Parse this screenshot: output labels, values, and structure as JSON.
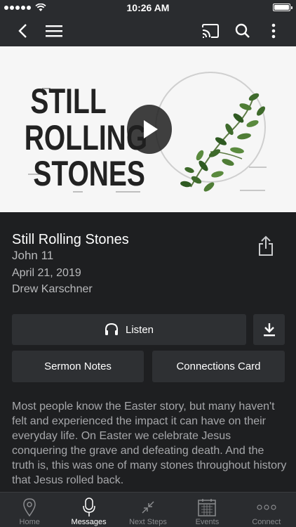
{
  "status": {
    "time": "10:26 AM"
  },
  "sermon": {
    "title": "Still Rolling Stones",
    "passage": "John 11",
    "date": "April 21, 2019",
    "speaker": "Drew Karschner",
    "artwork_text": [
      "STILL",
      "ROLLING",
      "STONES"
    ],
    "description": "Most people know the Easter story, but many haven't felt and experienced the impact it can have on their everyday life. On Easter we celebrate Jesus conquering the grave and defeating death. And the truth is, this was one of many stones throughout history that Jesus rolled back."
  },
  "actions": {
    "listen_label": "Listen",
    "notes_label": "Sermon Notes",
    "card_label": "Connections Card"
  },
  "tabs": [
    {
      "label": "Home",
      "icon": "location-pin-icon"
    },
    {
      "label": "Messages",
      "icon": "microphone-icon"
    },
    {
      "label": "Next Steps",
      "icon": "arrows-in-icon"
    },
    {
      "label": "Events",
      "icon": "calendar-icon"
    },
    {
      "label": "Connect",
      "icon": "more-dots-icon"
    }
  ],
  "active_tab": "Messages"
}
